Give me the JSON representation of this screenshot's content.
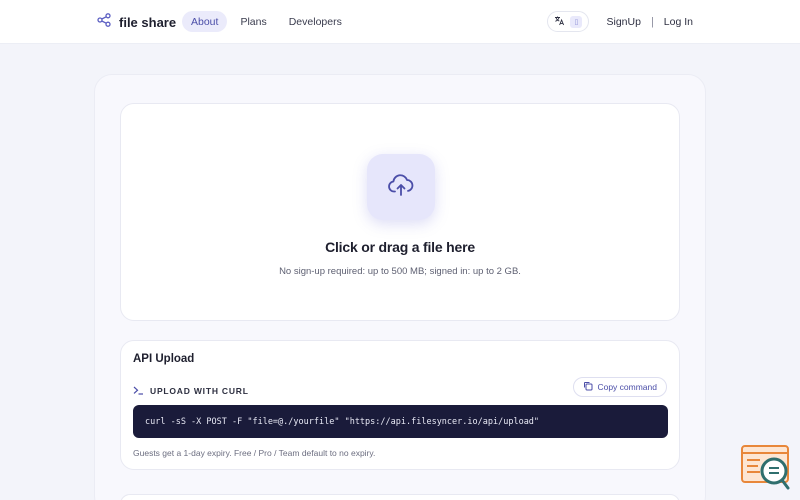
{
  "header": {
    "brand": "file share",
    "nav": [
      {
        "label": "About",
        "active": true
      },
      {
        "label": "Plans",
        "active": false
      },
      {
        "label": "Developers",
        "active": false
      }
    ],
    "lang_icon": "translate-icon",
    "signup": "SignUp",
    "separator": "|",
    "login": "Log In"
  },
  "dropzone": {
    "icon": "upload-cloud-icon",
    "title": "Click or drag a file here",
    "subtitle": "No sign-up required: up to 500 MB; signed in: up to 2 GB."
  },
  "api": {
    "title": "API Upload",
    "section_label": "UPLOAD WITH CURL",
    "copy_label": "Copy command",
    "command": "curl -sS -X POST -F \"file=@./yourfile\" \"https://api.filesyncer.io/api/upload\"",
    "note": "Guests get a 1-day expiry. Free / Pro / Team default to no expiry."
  },
  "colors": {
    "accent": "#4b4ea8",
    "accent_soft": "#e6e6fb",
    "code_bg": "#1a1b3a",
    "page_bg": "#f3f4fa",
    "chat_orange": "#e8873a",
    "chat_teal": "#2f6f6e"
  }
}
